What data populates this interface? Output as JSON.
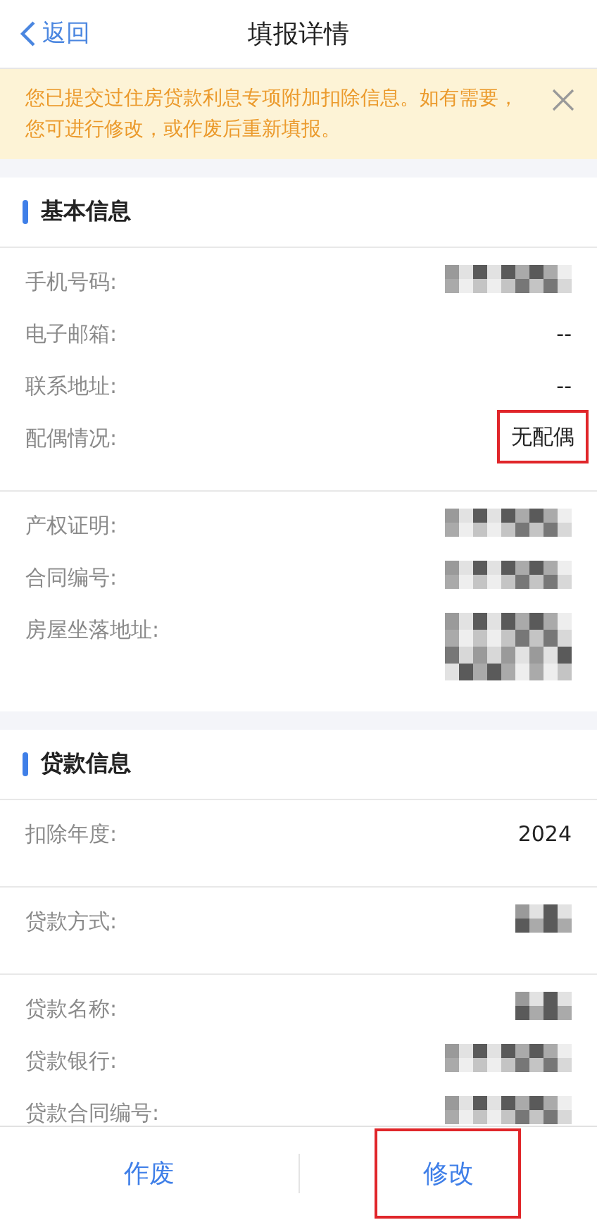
{
  "header": {
    "back_label": "返回",
    "title": "填报详情"
  },
  "notice": {
    "text": "您已提交过住房贷款利息专项附加扣除信息。如有需要，您可进行修改，或作废后重新填报。"
  },
  "sections": [
    {
      "title": "基本信息",
      "groups": [
        [
          {
            "label": "手机号码:",
            "kind": "redacted"
          },
          {
            "label": "电子邮箱:",
            "kind": "text",
            "value": "--",
            "highlighted": false
          },
          {
            "label": "联系地址:",
            "kind": "text",
            "value": "--",
            "highlighted": false
          },
          {
            "label": "配偶情况:",
            "kind": "text",
            "value": "无配偶",
            "highlighted": true
          }
        ],
        [
          {
            "label": "产权证明:",
            "kind": "redacted"
          },
          {
            "label": "合同编号:",
            "kind": "redacted"
          },
          {
            "label": "房屋坐落地址:",
            "kind": "redacted_tall"
          }
        ]
      ]
    },
    {
      "title": "贷款信息",
      "groups": [
        [
          {
            "label": "扣除年度:",
            "kind": "text",
            "value": "2024",
            "highlighted": false
          }
        ],
        [
          {
            "label": "贷款方式:",
            "kind": "redacted_short"
          }
        ],
        [
          {
            "label": "贷款名称:",
            "kind": "redacted_short"
          },
          {
            "label": "贷款银行:",
            "kind": "redacted"
          },
          {
            "label": "贷款合同编号:",
            "kind": "redacted"
          }
        ]
      ]
    }
  ],
  "footer": {
    "buttons": [
      {
        "label": "作废",
        "highlighted": false
      },
      {
        "label": "修改",
        "highlighted": true
      }
    ]
  }
}
